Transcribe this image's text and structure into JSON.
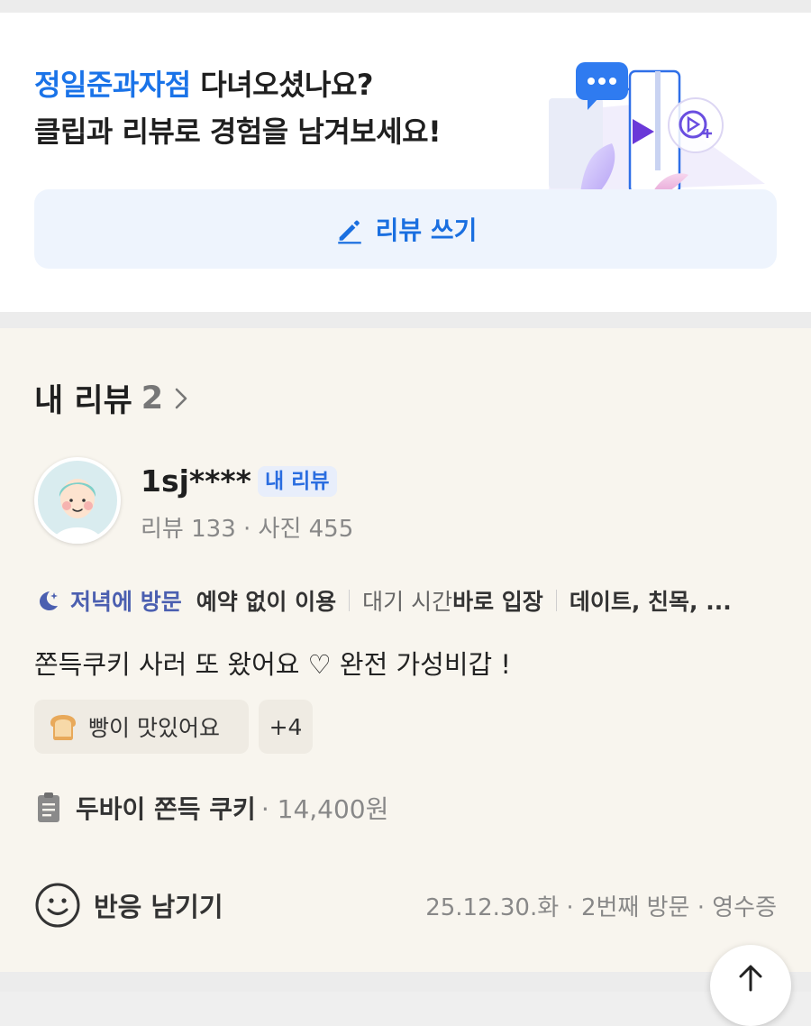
{
  "promo": {
    "place_name": "정일준과자점",
    "line1_rest": " 다녀오셨나요?",
    "line2": "클립과 리뷰로 경험을 남겨보세요!",
    "write_button": "리뷰 쓰기"
  },
  "my_reviews": {
    "title": "내 리뷰",
    "count": "2",
    "review": {
      "user_name": "1sj****",
      "my_badge": "내 리뷰",
      "stats": "리뷰 133 · 사진 455",
      "visit_time": "저녁에 방문",
      "reservation": "예약 없이 이용",
      "wait_label": "대기 시간 ",
      "wait_value": "바로 입장",
      "purpose": "데이트, 친목, ...",
      "body": "쫀득쿠키 사러 또 왔어요 ♡ 완전 가성비갑 !",
      "keyword_chip": "빵이 맛있어요",
      "keyword_more": "+4",
      "menu_name": "두바이 쫀득 쿠키",
      "menu_price": "· 14,400원",
      "react_label": "반응 남기기",
      "visit_meta": "25.12.30.화 · 2번째 방문 · 영수증"
    }
  },
  "colors": {
    "accent_blue": "#1a73e8",
    "visit_time": "#4b5fb0",
    "section_bg": "#f8f5ee"
  },
  "icons": [
    "pencil-icon",
    "chevron-right-icon",
    "moon-star-icon",
    "bread-icon",
    "receipt-icon",
    "smiley-icon",
    "arrow-up-icon",
    "play-icon",
    "chat-bubble-icon"
  ]
}
